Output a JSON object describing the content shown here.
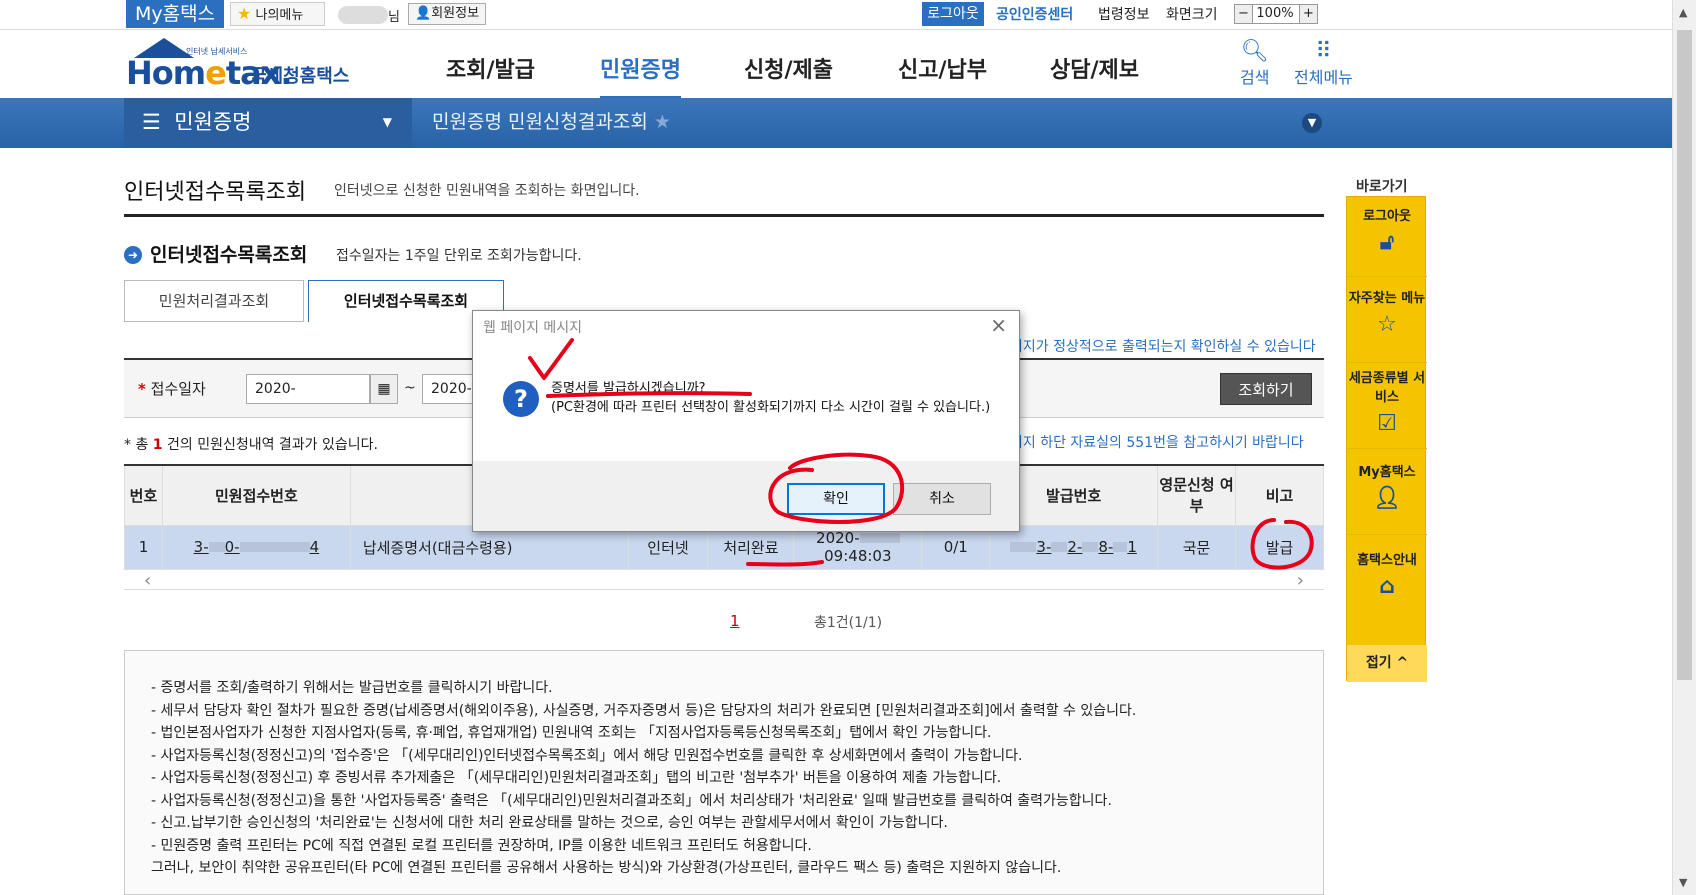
{
  "topbar": {
    "myhome": "My홈택스",
    "mymenu": "나의메뉴",
    "nim": "님",
    "member_info": "회원정보",
    "logout": "로그아웃",
    "cert_center": "공인인증센터",
    "law_info": "법령정보",
    "screen_size": "화면크기",
    "zoom_minus": "−",
    "zoom_value": "100%",
    "zoom_plus": "+"
  },
  "header": {
    "logo_tag": "인터넷 납세서비스",
    "logo_home": "Hom",
    "logo_e": "e",
    "logo_tax": "tax.",
    "logo_kr": "국세청홈택스",
    "gnb": [
      "조회/발급",
      "민원증명",
      "신청/제출",
      "신고/납부",
      "상담/제보"
    ],
    "search": "검색",
    "allmenu": "전체메뉴"
  },
  "bluebar": {
    "menu": "민원증명",
    "crumb": "민원증명 민원신청결과조회"
  },
  "page": {
    "title": "인터넷접수목록조회",
    "desc": "인터넷으로 신청한 민원내역을 조회하는 화면입니다.",
    "section_title": "인터넷접수목록조회",
    "section_desc": "접수일자는 1주일 단위로 조회가능합니다.",
    "tabs": [
      "민원처리결과조회",
      "인터넷접수목록조회"
    ],
    "search_label": "접수일자",
    "date_from": "2020-",
    "date_to": "2020-0",
    "search_button": "조회하기",
    "notice_right_1": "이지가 정상적으로 출력되는지 확인하실 수 있습니다",
    "notice_right_2": "이지 하단 자료실의 551번을 참고하시기 바랍니다",
    "total_pre": "* 총 ",
    "total_count": "1",
    "total_post": " 건의 민원신청내역 결과가 있습니다."
  },
  "table": {
    "headers": [
      "번호",
      "민원접수번호",
      "",
      "",
      "",
      "",
      "",
      "발급번호",
      "영문신청 여부",
      "비고"
    ],
    "row": {
      "no": "1",
      "receipt_no_head": "3-",
      "receipt_no_mid": "0-",
      "receipt_no_tail": "4",
      "name": "납세증명서(대금수령용)",
      "channel": "인터넷",
      "status": "처리완료",
      "date": "2020-",
      "time": "09:48:03",
      "count": "0/1",
      "issue_no_head": "3-",
      "issue_no_mid1": "2-",
      "issue_no_mid2": "8-",
      "issue_no_tail": "1",
      "lang": "국문",
      "remark": "발급"
    }
  },
  "pager": {
    "current": "1",
    "total": "총1건(1/1)"
  },
  "info_lines": [
    "- 증명서를 조회/출력하기 위해서는 발급번호를 클릭하시기 바랍니다.",
    "- 세무서 담당자 확인 절차가 필요한 증명(납세증명서(해외이주용), 사실증명, 거주자증명서 등)은 담당자의 처리가 완료되면 [민원처리결과조회]에서 출력할 수 있습니다.",
    "- 법인본점사업자가 신청한 지점사업자(등록, 휴·폐업, 휴업재개업) 민원내역 조회는 「지점사업자등록등신청목록조회」탭에서 확인 가능합니다.",
    "- 사업자등록신청(정정신고)의 '접수증'은 「(세무대리인)인터넷접수목록조회」에서 해당 민원접수번호를 클릭한 후 상세화면에서 출력이 가능합니다.",
    "- 사업자등록신청(정정신고) 후 증빙서류 추가제출은 「(세무대리인)민원처리결과조회」탭의 비고란 '첨부추가' 버튼을 이용하여 제출 가능합니다.",
    "- 사업자등록신청(정정신고)을 통한 '사업자등록증' 출력은 「(세무대리인)민원처리결과조회」에서 처리상태가 '처리완료' 일때 발급번호를 클릭하여 출력가능합니다.",
    "- 신고.납부기한 승인신청의 '처리완료'는 신청서에 대한 처리 완료상태를 말하는 것으로, 승인 여부는 관할세무서에서 확인이 가능합니다.",
    "- 민원증명 출력 프린터는 PC에 직접 연결된 로컬 프린터를 권장하며, IP를 이용한 네트워크 프린터도 허용합니다.",
    "  그러나, 보안이 취약한 공유프린터(타 PC에 연결된 프린터를 공유해서 사용하는 방식)와 가상환경(가상프린터, 클라우드 팩스 등) 출력은 지원하지 않습니다."
  ],
  "quickbar": {
    "title": "바로가기",
    "items": [
      "로그아웃",
      "자주찾는 메뉴",
      "세금종류별 서비스",
      "My홈택스",
      "홈택스안내"
    ],
    "fold": "접기"
  },
  "dialog": {
    "title": "웹 페이지 메시지",
    "question": "증명서를 발급하시겠습니까?",
    "detail": "(PC환경에 따라 프린터 선택창이 활성화되기까지 다소 시간이 걸릴 수 있습니다.)",
    "ok": "확인",
    "cancel": "취소"
  },
  "colors": {
    "brand_blue": "#2a6fc0",
    "bluebar": "#2962a6",
    "quickbar": "#f5c400",
    "annotation_red": "#e6001a",
    "selected_row": "#c9d8ef"
  }
}
